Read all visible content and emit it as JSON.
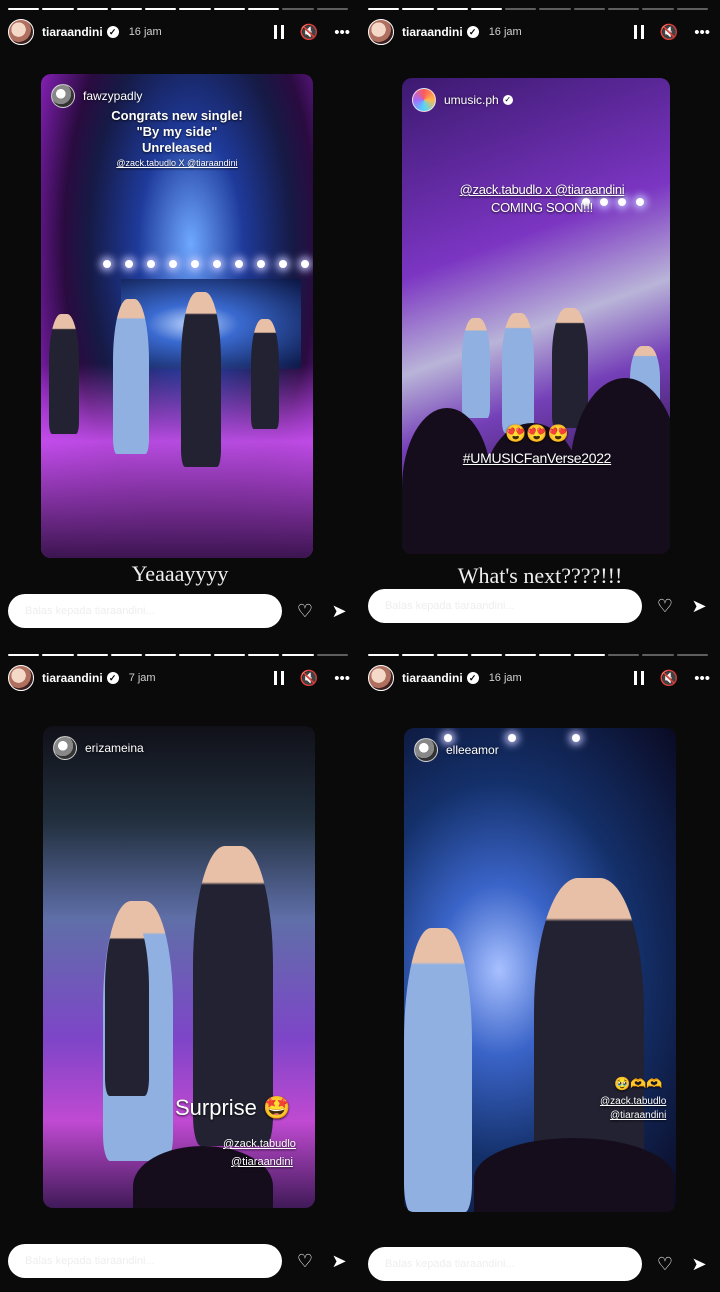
{
  "panels": [
    {
      "username": "tiaraandini",
      "time": "16 jam",
      "story_user": "fawzypadly",
      "caption_lines": [
        "Congrats new single!",
        "\"By my side\"",
        "Unreleased"
      ],
      "tags": "@zack.tabudlo X @tiaraandini",
      "caption": "Yeaaayyyy",
      "reply_placeholder": "Balas kepada tiaraandini...",
      "progress_done": 8,
      "progress_total": 10
    },
    {
      "username": "tiaraandini",
      "time": "16 jam",
      "story_user": "umusic.ph",
      "tags": "@zack.tabudlo x @tiaraandini",
      "coming": "COMING SOON!!!",
      "emojis": "😍😍😍",
      "hashtag": "#UMUSICFanVerse2022",
      "caption": "What's next????!!!",
      "reply_placeholder": "Balas kepada tiaraandini...",
      "progress_done": 4,
      "progress_total": 10
    },
    {
      "username": "tiaraandini",
      "time": "7 jam",
      "story_user": "erizameina",
      "surprise": "Surprise 🤩",
      "tag1": "@zack.tabudlo",
      "tag2": "@tiaraandini",
      "reply_placeholder": "Balas kepada tiaraandini...",
      "progress_done": 9,
      "progress_total": 10
    },
    {
      "username": "tiaraandini",
      "time": "16 jam",
      "story_user": "elleeamor",
      "emojis": "🥹🫶🫶",
      "tag1": "@zack.tabudlo",
      "tag2": "@tiaraandini",
      "reply_placeholder": "Balas kepada tiaraandini...",
      "progress_done": 7,
      "progress_total": 10
    }
  ],
  "icons": {
    "pause": "pause-icon",
    "mute": "🔇",
    "more": "•••",
    "like": "♡",
    "send": "➤"
  }
}
